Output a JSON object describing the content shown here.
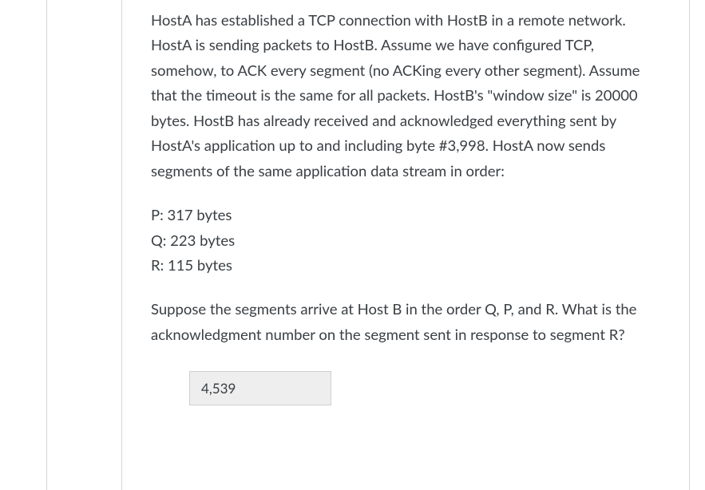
{
  "question": {
    "intro": "HostA has established a TCP connection with HostB in a remote network. HostA is sending packets to HostB. Assume we have configured TCP, somehow, to ACK every segment (no ACKing every other segment). Assume that the timeout is the same for all packets. HostB's \"window size\" is 20000 bytes. HostB has already received and acknowledged everything sent by HostA's application up to and including byte #3,998. HostA now sends segments of the same application data stream in order:",
    "segments_text": "P: 317 bytes\nQ: 223 bytes\nR: 115 bytes",
    "segments": [
      {
        "label": "P",
        "bytes": 317
      },
      {
        "label": "Q",
        "bytes": 223
      },
      {
        "label": "R",
        "bytes": 115
      }
    ],
    "prompt": "Suppose the segments arrive at Host B in the order Q, P, and R. What is the acknowledgment number on the segment sent in response to segment R?",
    "answer": "4,539"
  }
}
